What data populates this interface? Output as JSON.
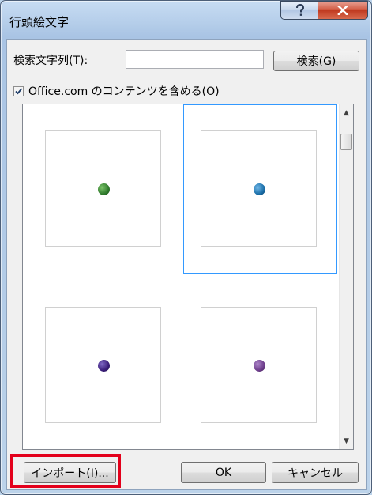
{
  "window": {
    "title": "行頭絵文字"
  },
  "search": {
    "label": "検索文字列(T):",
    "value": "",
    "button_label": "検索(G)"
  },
  "include_online": {
    "label": "Office.com のコンテンツを含める(O)",
    "checked": true
  },
  "gallery": {
    "items": [
      {
        "icon": "green-bullet",
        "color": "#2f7a2c"
      },
      {
        "icon": "blue-bullet",
        "color": "#1a6ea8",
        "selected": true
      },
      {
        "icon": "purple-bullet",
        "color": "#3a1d7a"
      },
      {
        "icon": "violet-bullet",
        "color": "#6e3d8c"
      }
    ]
  },
  "buttons": {
    "import": "インポート(I)...",
    "ok": "OK",
    "cancel": "キャンセル"
  },
  "highlight_color": "#e3001b"
}
